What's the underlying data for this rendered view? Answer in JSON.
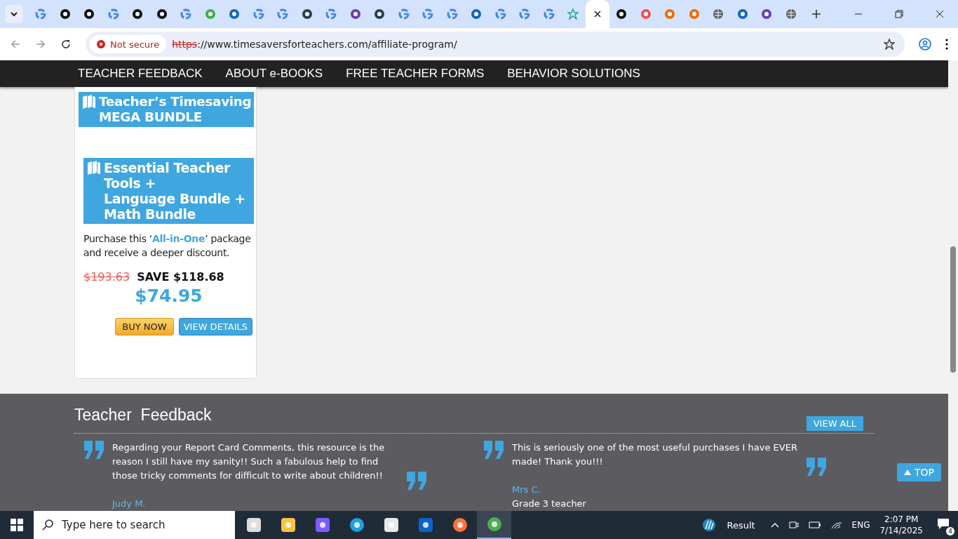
{
  "browser": {
    "tabs": [
      {
        "kind": "google",
        "selected": false
      },
      {
        "kind": "dark",
        "selected": false
      },
      {
        "kind": "dark",
        "selected": false
      },
      {
        "kind": "google",
        "selected": false
      },
      {
        "kind": "dark",
        "selected": false
      },
      {
        "kind": "dark",
        "selected": false
      },
      {
        "kind": "google",
        "selected": false
      },
      {
        "kind": "green",
        "selected": false
      },
      {
        "kind": "blue",
        "selected": false
      },
      {
        "kind": "google",
        "selected": false
      },
      {
        "kind": "google",
        "selected": false
      },
      {
        "kind": "stack",
        "selected": false
      },
      {
        "kind": "google",
        "selected": false
      },
      {
        "kind": "purple",
        "selected": false
      },
      {
        "kind": "stack",
        "selected": false
      },
      {
        "kind": "google",
        "selected": false
      },
      {
        "kind": "google",
        "selected": false
      },
      {
        "kind": "google",
        "selected": false
      },
      {
        "kind": "blue",
        "selected": false
      },
      {
        "kind": "google",
        "selected": false
      },
      {
        "kind": "google",
        "selected": false
      },
      {
        "kind": "google",
        "selected": false
      },
      {
        "kind": "star",
        "selected": false
      },
      {
        "selected": true
      },
      {
        "kind": "dark",
        "selected": false
      },
      {
        "kind": "red",
        "selected": false
      },
      {
        "kind": "orange",
        "selected": false
      },
      {
        "kind": "orange",
        "selected": false
      },
      {
        "kind": "globe",
        "selected": false
      },
      {
        "kind": "blue",
        "selected": false
      },
      {
        "kind": "purple",
        "selected": false
      },
      {
        "kind": "globe",
        "selected": false
      }
    ],
    "security_label": "Not secure",
    "url_scheme": "https",
    "url_rest": "://www.timesaversforteachers.com/affiliate-program/"
  },
  "nav": [
    {
      "label": "TEACHER FEEDBACK"
    },
    {
      "label": "ABOUT e-BOOKS"
    },
    {
      "label": "FREE TEACHER FORMS"
    },
    {
      "label": "BEHAVIOR SOLUTIONS"
    }
  ],
  "bundle_banner": {
    "title_lines": [
      "Teacher’s Timesaving",
      "MEGA BUNDLE"
    ]
  },
  "product": {
    "title_lines": [
      "Essential Teacher",
      "Tools +",
      "Language Bundle +",
      "Math Bundle"
    ],
    "description_before": "Purchase this ‘",
    "description_link": "All-in-One",
    "description_after": "’ package and receive a deeper discount.",
    "old_price": "$193.63",
    "save": "SAVE $118.68",
    "price": "$74.95",
    "buy": "BUY NOW",
    "details": "VIEW DETAILS"
  },
  "feedback": {
    "title": "Teacher  Feedback",
    "view_all": "VIEW ALL",
    "top": "TOP",
    "items": [
      {
        "text": "Regarding your Report Card Comments, this resource is the reason I still have my sanity!! Such a fabulous help to find those tricky comments for difficult to write about children!!",
        "author": "Judy M."
      },
      {
        "text": "This is seriously one of the most useful purchases I have EVER made! Thank you!!!",
        "author": "Mrs C.",
        "role": "Grade 3 teacher"
      }
    ]
  },
  "taskbar": {
    "search_placeholder": "Type here to search",
    "apps": [
      {
        "kind": "taskview",
        "selected": false
      },
      {
        "kind": "folder",
        "selected": false
      },
      {
        "kind": "copilot",
        "selected": false
      },
      {
        "kind": "edge",
        "selected": false
      },
      {
        "kind": "store",
        "selected": false
      },
      {
        "kind": "outlook",
        "selected": false
      },
      {
        "kind": "firefox",
        "selected": false
      },
      {
        "kind": "chrome",
        "selected": true
      }
    ],
    "weather": "Result",
    "language": "ENG",
    "time": "2:07 PM",
    "date": "7/14/2025",
    "notifications": "4"
  }
}
